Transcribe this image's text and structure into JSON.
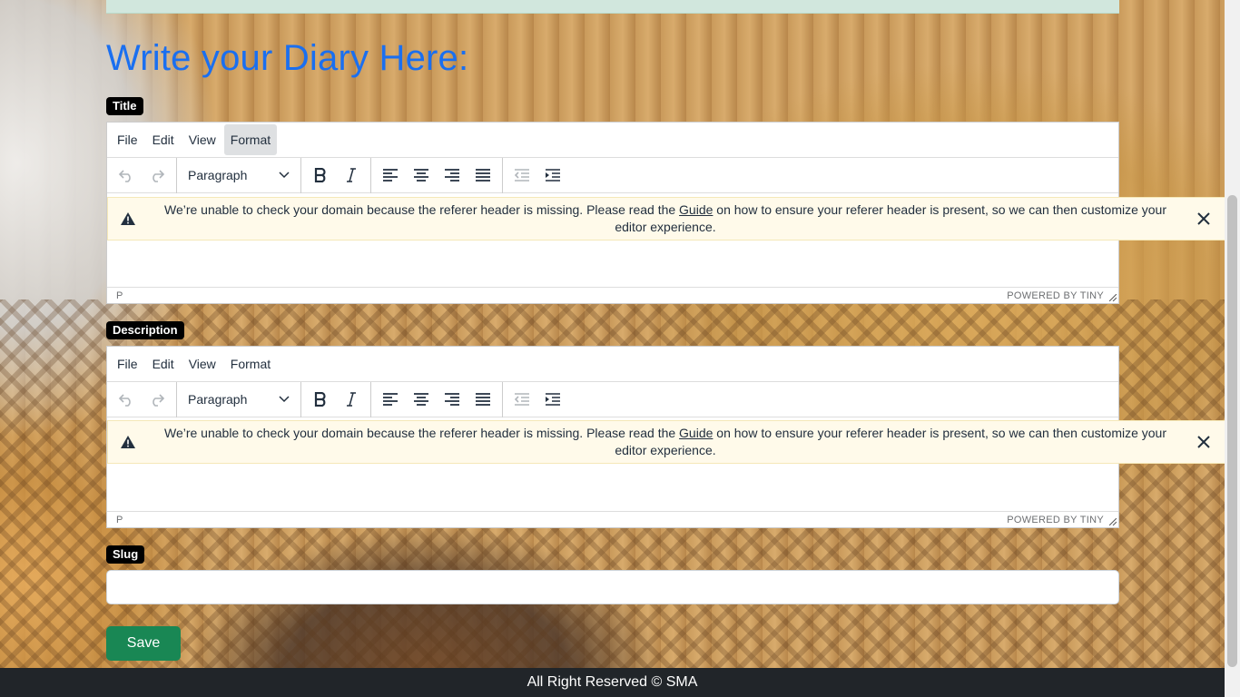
{
  "page": {
    "heading": "Write your Diary Here:"
  },
  "editor_menu": [
    "File",
    "Edit",
    "View",
    "Format"
  ],
  "block_format": "Paragraph",
  "notice": {
    "before_link": "We’re unable to check your domain because the referer header is missing. Please read the ",
    "link": "Guide",
    "after_link": " on how to ensure your referer header is present, so we can then customize your editor experience."
  },
  "status_path": "P",
  "branding": "POWERED BY TINY",
  "fields": {
    "title_label": "Title",
    "description_label": "Description",
    "slug_label": "Slug",
    "slug_value": ""
  },
  "actions": {
    "save_label": "Save"
  },
  "footer": {
    "text": "All Right Reserved © SMA"
  },
  "colors": {
    "heading": "#1a6ff0",
    "save_button": "#198754",
    "footer_bg": "#212529",
    "notice_bg": "#fffaea"
  }
}
